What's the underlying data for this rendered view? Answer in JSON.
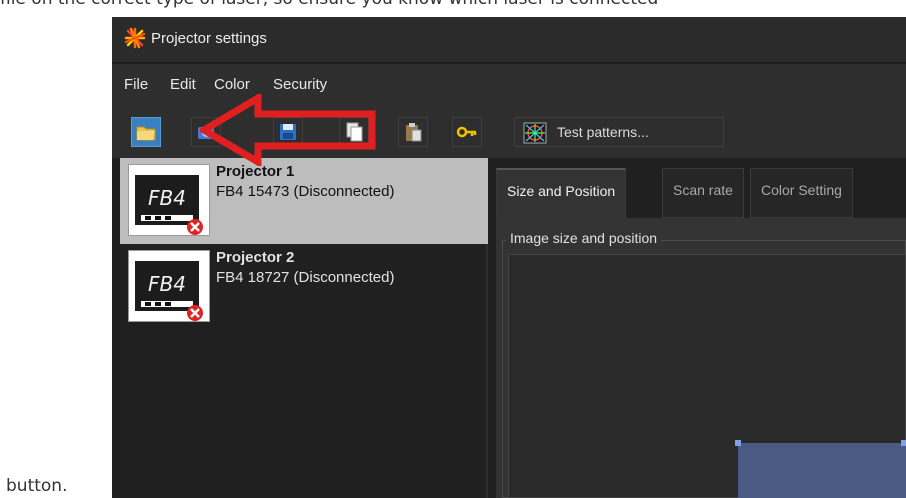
{
  "doc": {
    "top_text": "file on the correct type of laser, so ensure you know which laser is connected",
    "bottom_text": "button."
  },
  "window": {
    "title": "Projector settings",
    "title_icon": "starburst-app-icon"
  },
  "menu": [
    "File",
    "Edit",
    "Color",
    "Security"
  ],
  "toolbar": {
    "buttons": [
      {
        "name": "open-folder-icon",
        "active": true
      },
      {
        "name": "camera-icon",
        "active": false
      },
      {
        "name": "save-icon",
        "active": false
      },
      {
        "name": "copy-icon",
        "active": false
      },
      {
        "name": "paste-icon",
        "active": false
      },
      {
        "name": "key-icon",
        "active": false
      }
    ],
    "test_patterns_label": "Test patterns..."
  },
  "projectors": [
    {
      "name": "Projector 1",
      "status": "FB4 15473 (Disconnected)",
      "thumb": "FB4",
      "selected": true
    },
    {
      "name": "Projector 2",
      "status": "FB4 18727 (Disconnected)",
      "thumb": "FB4",
      "selected": false
    }
  ],
  "tabs": [
    {
      "label": "Size and Position",
      "active": true
    },
    {
      "label": "Scan rate",
      "active": false
    },
    {
      "label": "Color Setting",
      "active": false
    }
  ],
  "panel": {
    "group_label": "Image size and position"
  },
  "colors": {
    "annotation_arrow": "#e02020",
    "selection": "#bdbdbd",
    "accent": "#3a7fc0"
  }
}
